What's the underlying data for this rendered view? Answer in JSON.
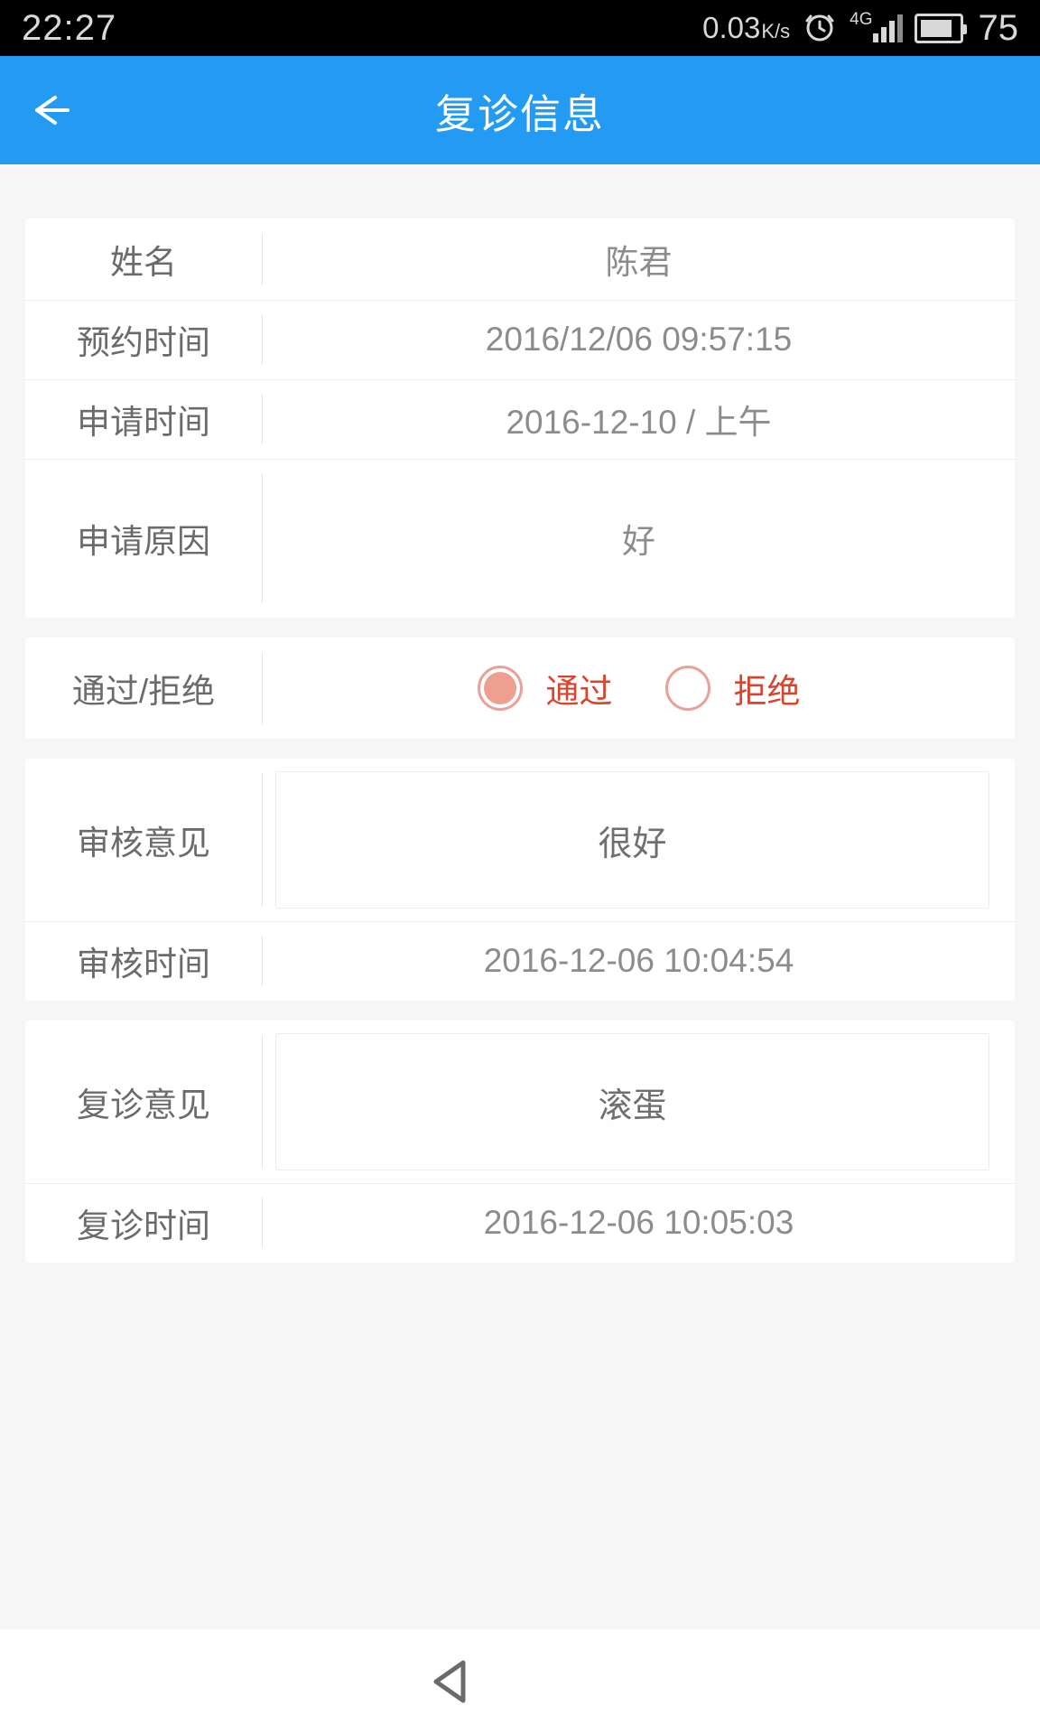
{
  "statusbar": {
    "time": "22:27",
    "net_speed": "0.03",
    "net_speed_unit": "K/s",
    "alarm_icon": "alarm-clock-icon",
    "network_type": "4G",
    "battery_level": "75"
  },
  "appbar": {
    "back_icon": "back-arrow-icon",
    "title": "复诊信息"
  },
  "form": {
    "cards": [
      {
        "rows": [
          {
            "label": "姓名",
            "value": "陈君",
            "type": "text",
            "size": "name"
          },
          {
            "label": "预约时间",
            "value": "2016/12/06 09:57:15",
            "type": "text",
            "size": "std"
          },
          {
            "label": "申请时间",
            "value": "2016-12-10 / 上午",
            "type": "text",
            "size": "std"
          },
          {
            "label": "申请原因",
            "value": "好",
            "type": "text",
            "size": "tall"
          }
        ]
      },
      {
        "rows": [
          {
            "label": "通过/拒绝",
            "type": "radio",
            "size": "radio"
          }
        ]
      },
      {
        "rows": [
          {
            "label": "审核意见",
            "value": "很好",
            "type": "box",
            "size": "box"
          },
          {
            "label": "审核时间",
            "value": "2016-12-06 10:04:54",
            "type": "text",
            "size": "std"
          }
        ]
      },
      {
        "rows": [
          {
            "label": "复诊意见",
            "value": "滚蛋",
            "type": "box",
            "size": "box"
          },
          {
            "label": "复诊时间",
            "value": "2016-12-06 10:05:03",
            "type": "text",
            "size": "std"
          }
        ]
      }
    ],
    "approval": {
      "label": "通过/拒绝",
      "options": [
        {
          "label": "通过",
          "selected": true
        },
        {
          "label": "拒绝",
          "selected": false
        }
      ],
      "accent_color": "#d9442c",
      "radio_fill_color": "#ef9f8f"
    }
  },
  "navbar": {
    "back_icon": "nav-back-triangle-icon"
  },
  "colors": {
    "appbar_blue": "#249bf2",
    "page_background": "#f6f6f6",
    "card_background": "#ffffff",
    "label_text": "#6b6b6b",
    "value_text": "#8c8c8c"
  }
}
